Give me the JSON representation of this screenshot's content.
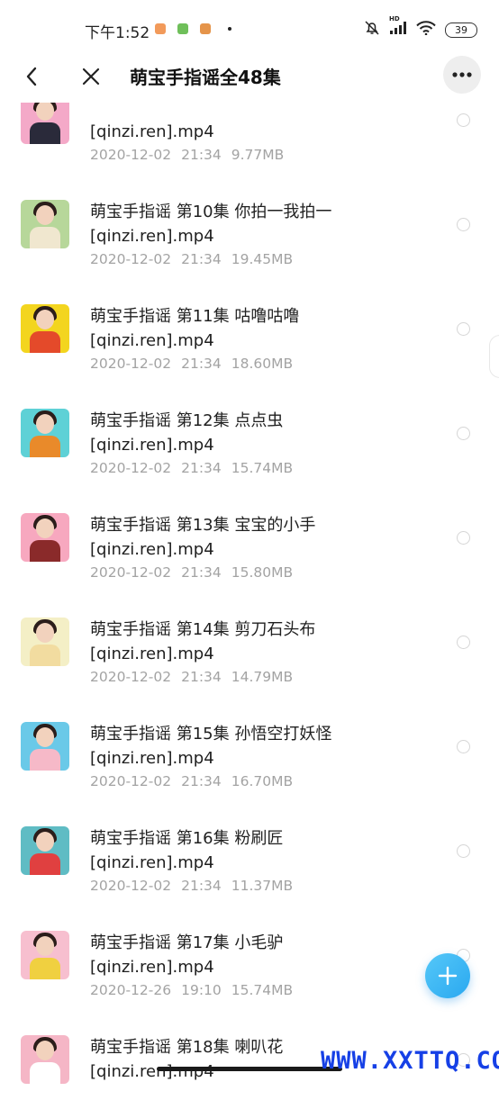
{
  "status_bar": {
    "time": "下午1:52",
    "battery": "39",
    "hd": "HD"
  },
  "nav": {
    "title": "萌宝手指谣全48集"
  },
  "files": [
    {
      "name_line1": "",
      "name_line2": "[qinzi.ren].mp4",
      "date": "2020-12-02",
      "time": "21:34",
      "size": "9.77MB"
    },
    {
      "name_line1": "萌宝手指谣 第10集 你拍一我拍一",
      "name_line2": "[qinzi.ren].mp4",
      "date": "2020-12-02",
      "time": "21:34",
      "size": "19.45MB"
    },
    {
      "name_line1": "萌宝手指谣 第11集 咕噜咕噜",
      "name_line2": "[qinzi.ren].mp4",
      "date": "2020-12-02",
      "time": "21:34",
      "size": "18.60MB"
    },
    {
      "name_line1": "萌宝手指谣 第12集 点点虫",
      "name_line2": "[qinzi.ren].mp4",
      "date": "2020-12-02",
      "time": "21:34",
      "size": "15.74MB"
    },
    {
      "name_line1": "萌宝手指谣 第13集 宝宝的小手",
      "name_line2": "[qinzi.ren].mp4",
      "date": "2020-12-02",
      "time": "21:34",
      "size": "15.80MB"
    },
    {
      "name_line1": "萌宝手指谣 第14集 剪刀石头布",
      "name_line2": "[qinzi.ren].mp4",
      "date": "2020-12-02",
      "time": "21:34",
      "size": "14.79MB"
    },
    {
      "name_line1": "萌宝手指谣 第15集 孙悟空打妖怪",
      "name_line2": "[qinzi.ren].mp4",
      "date": "2020-12-02",
      "time": "21:34",
      "size": "16.70MB"
    },
    {
      "name_line1": "萌宝手指谣 第16集 粉刷匠",
      "name_line2": "[qinzi.ren].mp4",
      "date": "2020-12-02",
      "time": "21:34",
      "size": "11.37MB"
    },
    {
      "name_line1": "萌宝手指谣 第17集 小毛驴",
      "name_line2": "[qinzi.ren].mp4",
      "date": "2020-12-26",
      "time": "19:10",
      "size": "15.74MB"
    },
    {
      "name_line1": "萌宝手指谣 第18集 喇叭花",
      "name_line2": "[qinzi.ren].mp4",
      "date": "",
      "time": "",
      "size": ""
    }
  ],
  "thumb_colors": [
    "#f4a9c8",
    "#b7d79a",
    "#f3d51f",
    "#5ed1d6",
    "#f7a8bf",
    "#f4efc6",
    "#6ac9e8",
    "#5fbcc4",
    "#f7bfcf",
    "#f5b6c6"
  ],
  "shirt_colors": [
    "#2a2a3a",
    "#f0e7cf",
    "#e44a2a",
    "#e98a2a",
    "#8a2a2a",
    "#f2dca0",
    "#f6b9c8",
    "#e04040",
    "#f0d040",
    "#ffffff"
  ],
  "accent_color": "#2aa8f0",
  "watermark": "WWW.XXTTQ.COM"
}
